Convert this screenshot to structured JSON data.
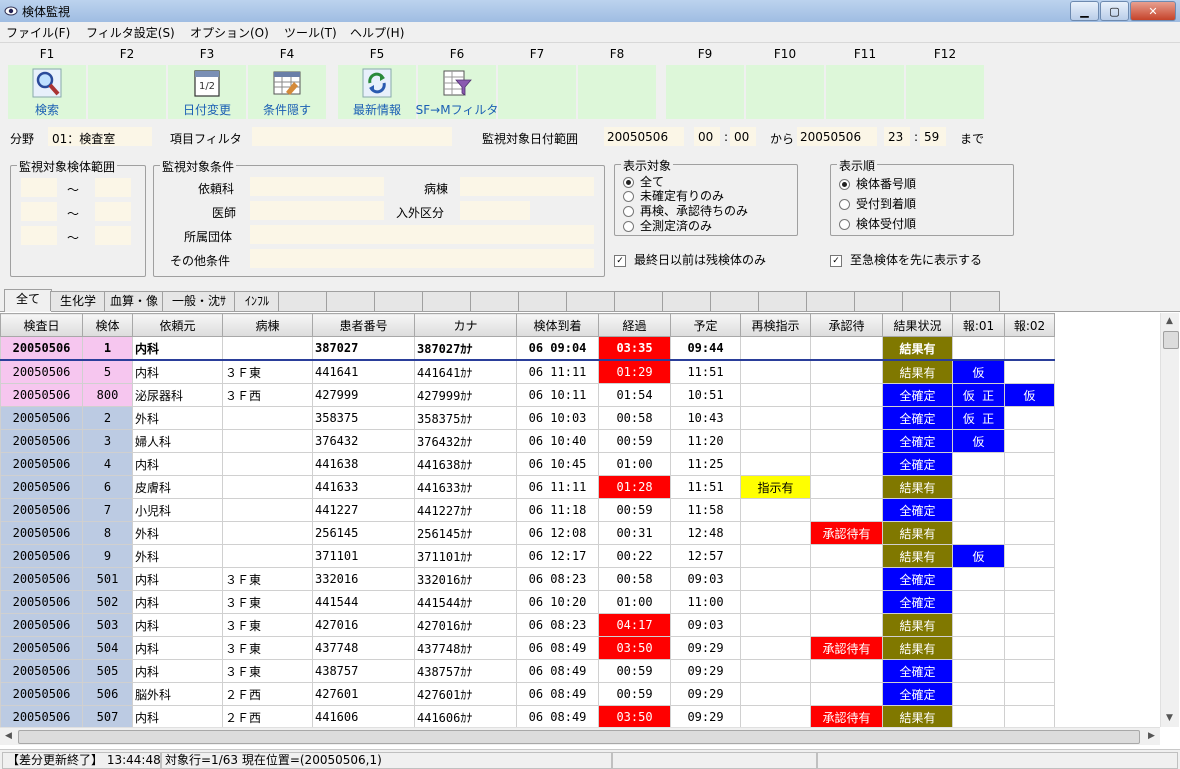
{
  "window": {
    "title": "検体監視"
  },
  "menu": [
    "ファイル(F)",
    "フィルタ設定(S)",
    "オプション(O)",
    "ツール(T)",
    "ヘルプ(H)"
  ],
  "fkeys": [
    {
      "key": "F1",
      "label": "検索",
      "icon": "search-icon"
    },
    {
      "key": "F2",
      "label": ""
    },
    {
      "key": "F3",
      "label": "日付変更",
      "icon": "calendar-icon"
    },
    {
      "key": "F4",
      "label": "条件隠す",
      "icon": "grid-icon"
    },
    {
      "key": "F5",
      "label": "最新情報",
      "icon": "refresh-icon"
    },
    {
      "key": "F6",
      "label": "SF→Mフィルタ",
      "icon": "filter-icon"
    },
    {
      "key": "F7",
      "label": ""
    },
    {
      "key": "F8",
      "label": ""
    },
    {
      "key": "F9",
      "label": ""
    },
    {
      "key": "F10",
      "label": ""
    },
    {
      "key": "F11",
      "label": ""
    },
    {
      "key": "F12",
      "label": ""
    }
  ],
  "conditions": {
    "field_label": "分野",
    "field_value": "01：検査室",
    "item_filter_label": "項目フィルタ",
    "date_range_label": "監視対象日付範囲",
    "date_from": "20050506",
    "time_from_h": "00",
    "time_from_m": "00",
    "from_label": "から",
    "date_to": "20050506",
    "time_to_h": "23",
    "time_to_m": "59",
    "to_label": "まで",
    "colon": ":",
    "range_group_label": "監視対象検体範囲",
    "tilde": "～",
    "target_group_label": "監視対象条件",
    "dept_label": "依頼科",
    "ward_label": "病棟",
    "doctor_label": "医師",
    "inout_label": "入外区分",
    "org_label": "所属団体",
    "other_label": "その他条件",
    "display_group_label": "表示対象",
    "display_options": [
      "全て",
      "未確定有りのみ",
      "再検、承認待ちのみ",
      "全測定済のみ"
    ],
    "display_selected": 0,
    "order_group_label": "表示順",
    "order_options": [
      "検体番号順",
      "受付到着順",
      "検体受付順"
    ],
    "order_selected": 0,
    "check_last_day": "最終日以前は残検体のみ",
    "check_urgent": "至急検体を先に表示する",
    "check_mark": "✓"
  },
  "tabs": [
    "全て",
    "生化学",
    "血算・像",
    "一般・沈ｻ",
    "ｲﾝﾌﾙ",
    "",
    "",
    "",
    "",
    "",
    "",
    "",
    "",
    "",
    "",
    "",
    "",
    "",
    "",
    "",
    ""
  ],
  "columns": [
    "検査日",
    "検体",
    "依頼元",
    "病棟",
    "患者番号",
    "カナ",
    "検体到着",
    "経過",
    "予定",
    "再検指示",
    "承認待",
    "結果状況",
    "報:01",
    "報:02"
  ],
  "rows": [
    [
      "20050506",
      "1",
      "内科",
      "",
      "387027",
      "387027ｶﾅ",
      "06 09:04",
      "03:35",
      "09:44",
      "",
      "",
      "結果有",
      "",
      ""
    ],
    [
      "20050506",
      "5",
      "内科",
      "３Ｆ東",
      "441641",
      "441641ｶﾅ",
      "06 11:11",
      "01:29",
      "11:51",
      "",
      "",
      "結果有",
      "仮",
      ""
    ],
    [
      "20050506",
      "800",
      "泌尿器科",
      "３Ｆ西",
      "427999",
      "427999ｶﾅ",
      "06 10:11",
      "01:54",
      "10:51",
      "",
      "",
      "全確定",
      "仮 正",
      "仮"
    ],
    [
      "20050506",
      "2",
      "外科",
      "",
      "358375",
      "358375ｶﾅ",
      "06 10:03",
      "00:58",
      "10:43",
      "",
      "",
      "全確定",
      "仮 正",
      ""
    ],
    [
      "20050506",
      "3",
      "婦人科",
      "",
      "376432",
      "376432ｶﾅ",
      "06 10:40",
      "00:59",
      "11:20",
      "",
      "",
      "全確定",
      "仮",
      ""
    ],
    [
      "20050506",
      "4",
      "内科",
      "",
      "441638",
      "441638ｶﾅ",
      "06 10:45",
      "01:00",
      "11:25",
      "",
      "",
      "全確定",
      "",
      ""
    ],
    [
      "20050506",
      "6",
      "皮膚科",
      "",
      "441633",
      "441633ｶﾅ",
      "06 11:11",
      "01:28",
      "11:51",
      "指示有",
      "",
      "結果有",
      "",
      ""
    ],
    [
      "20050506",
      "7",
      "小児科",
      "",
      "441227",
      "441227ｶﾅ",
      "06 11:18",
      "00:59",
      "11:58",
      "",
      "",
      "全確定",
      "",
      ""
    ],
    [
      "20050506",
      "8",
      "外科",
      "",
      "256145",
      "256145ｶﾅ",
      "06 12:08",
      "00:31",
      "12:48",
      "",
      "承認待有",
      "結果有",
      "",
      ""
    ],
    [
      "20050506",
      "9",
      "外科",
      "",
      "371101",
      "371101ｶﾅ",
      "06 12:17",
      "00:22",
      "12:57",
      "",
      "",
      "結果有",
      "仮",
      ""
    ],
    [
      "20050506",
      "501",
      "内科",
      "３Ｆ東",
      "332016",
      "332016ｶﾅ",
      "06 08:23",
      "00:58",
      "09:03",
      "",
      "",
      "全確定",
      "",
      ""
    ],
    [
      "20050506",
      "502",
      "内科",
      "３Ｆ東",
      "441544",
      "441544ｶﾅ",
      "06 10:20",
      "01:00",
      "11:00",
      "",
      "",
      "全確定",
      "",
      ""
    ],
    [
      "20050506",
      "503",
      "内科",
      "３Ｆ東",
      "427016",
      "427016ｶﾅ",
      "06 08:23",
      "04:17",
      "09:03",
      "",
      "",
      "結果有",
      "",
      ""
    ],
    [
      "20050506",
      "504",
      "内科",
      "３Ｆ東",
      "437748",
      "437748ｶﾅ",
      "06 08:49",
      "03:50",
      "09:29",
      "",
      "承認待有",
      "結果有",
      "",
      ""
    ],
    [
      "20050506",
      "505",
      "内科",
      "３Ｆ東",
      "438757",
      "438757ｶﾅ",
      "06 08:49",
      "00:59",
      "09:29",
      "",
      "",
      "全確定",
      "",
      ""
    ],
    [
      "20050506",
      "506",
      "脳外科",
      "２Ｆ西",
      "427601",
      "427601ｶﾅ",
      "06 08:49",
      "00:59",
      "09:29",
      "",
      "",
      "全確定",
      "",
      ""
    ],
    [
      "20050506",
      "507",
      "内科",
      "２Ｆ西",
      "441606",
      "441606ｶﾅ",
      "06 08:49",
      "03:50",
      "09:29",
      "",
      "承認待有",
      "結果有",
      "",
      ""
    ]
  ],
  "highlight": {
    "pink_rows": [
      0,
      1,
      2
    ],
    "red_elapsed_rows": [
      0,
      1,
      6,
      12,
      13,
      16
    ]
  },
  "status": {
    "left": "【差分更新終了】 13:44:48",
    "right": "対象行=1/63 現在位置=(20050506,1)"
  },
  "colors": {
    "blue": "#0000ff",
    "olive": "#807800",
    "red": "#ff0000",
    "yellow": "#ffff00",
    "fkey_bg": "#ddf7d9",
    "field_bg": "#fbf6e7",
    "id_bg": "#bccbe3",
    "pink": "#f6c6ef"
  }
}
